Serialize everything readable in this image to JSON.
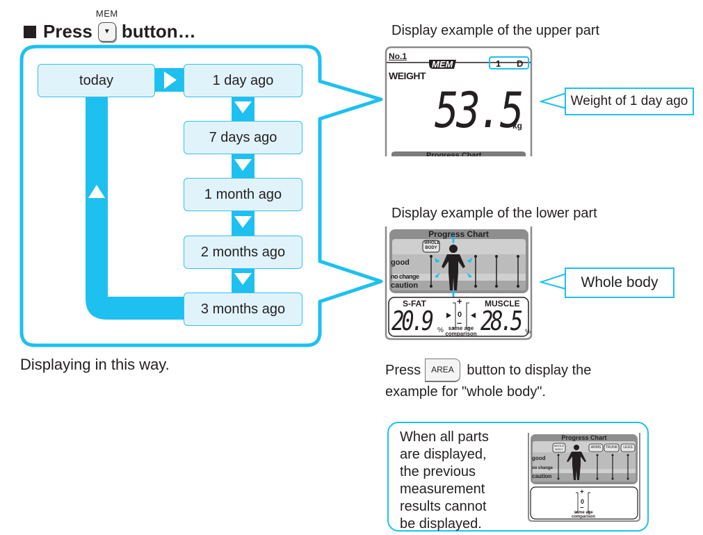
{
  "heading": {
    "prefix": "Press",
    "key_top_label": "MEM",
    "key_glyph": "▼",
    "suffix": "button…"
  },
  "flow": {
    "steps": [
      {
        "label": "today"
      },
      {
        "label": "1 day ago"
      },
      {
        "label": "7 days ago"
      },
      {
        "label": "1 month ago"
      },
      {
        "label": "2 months ago"
      },
      {
        "label": "3 months ago"
      }
    ],
    "caption": "Displaying in this way.",
    "accent_color": "#1ec0ef",
    "step_fill": "#e0f3fb"
  },
  "upper_example": {
    "title": "Display example of the upper part",
    "user_no": "No.1",
    "mem_tag": "MEM",
    "period_value": "1",
    "period_unit": "D",
    "metric_label": "WEIGHT",
    "weight_value": "53.5",
    "weight_unit": "kg",
    "chart_peek_label": "Progress Chart",
    "callout": "Weight of 1 day ago"
  },
  "lower_example": {
    "title": "Display example of the lower part",
    "chart_title": "Progress Chart",
    "area_tag_line1": "WHOLE",
    "area_tag_line2": "BODY",
    "levels": [
      "good",
      "no change",
      "caution"
    ],
    "sfat_label": "S-FAT",
    "sfat_value": "20.9",
    "sfat_unit": "%",
    "muscle_label": "MUSCLE",
    "muscle_value": "28.5",
    "muscle_unit": "%",
    "scale_plus": "+",
    "scale_zero": "0",
    "scale_minus": "–",
    "comparison_line1": "same age",
    "comparison_line2": "comparison",
    "callout": "Whole body"
  },
  "area_note": {
    "prefix": "Press",
    "key_label": "AREA",
    "suffix_line1": "button to display the",
    "line2": "example for \"whole body\"."
  },
  "info_box": {
    "text_lines": [
      "When all parts",
      "are displayed,",
      "the previous",
      "measurement",
      "results cannot",
      "be displayed."
    ],
    "chart_title": "Progress Chart",
    "tags": [
      "WHOLE BODY",
      "ARMS",
      "TRUNK",
      "LEGS"
    ],
    "levels": [
      "good",
      "no change",
      "caution"
    ],
    "scale_plus": "+",
    "scale_zero": "0",
    "scale_minus": "–",
    "comparison_line1": "same age",
    "comparison_line2": "comparison"
  }
}
